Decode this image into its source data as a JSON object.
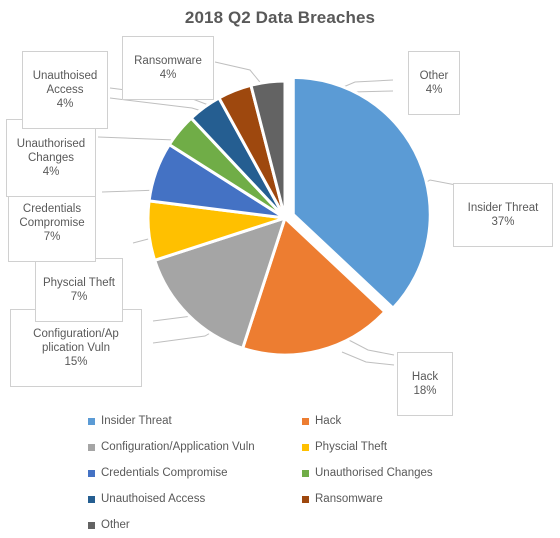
{
  "chart_data": {
    "type": "pie",
    "title": "2018 Q2 Data Breaches",
    "xlabel": "",
    "ylabel": "",
    "legend_position": "bottom",
    "grid": false,
    "start_angle_deg": 0,
    "direction": "clockwise",
    "exploded_slice_index": 0,
    "categories": [
      "Insider Threat",
      "Hack",
      "Configuration/Application Vuln",
      "Physcial Theft",
      "Credentials Compromise",
      "Unauthorised Changes",
      "Unauthoised Access",
      "Ransomware",
      "Other"
    ],
    "values": [
      37,
      18,
      15,
      7,
      7,
      4,
      4,
      4,
      4
    ],
    "value_labels": [
      "37%",
      "18%",
      "15%",
      "7%",
      "7%",
      "4%",
      "4%",
      "4%",
      "4%"
    ],
    "colors": [
      "#5B9BD5",
      "#ED7D31",
      "#A5A5A5",
      "#FFC000",
      "#4472C4",
      "#70AD47",
      "#255E91",
      "#9E480E",
      "#636363"
    ]
  },
  "callouts": [
    {
      "name": "insider-threat",
      "label": "Insider Threat",
      "pct": "37%"
    },
    {
      "name": "hack",
      "label": "Hack",
      "pct": "18%"
    },
    {
      "name": "configuration-application-vuln",
      "label": "Configuration/Ap\nplication Vuln",
      "pct": "15%"
    },
    {
      "name": "physcial-theft",
      "label": "Physcial Theft",
      "pct": "7%"
    },
    {
      "name": "credentials-compromise",
      "label": "Credentials\nCompromise",
      "pct": "7%"
    },
    {
      "name": "unauthorised-changes",
      "label": "Unauthorised\nChanges",
      "pct": "4%"
    },
    {
      "name": "unauthoised-access",
      "label": "Unauthoised\nAccess",
      "pct": "4%"
    },
    {
      "name": "ransomware",
      "label": "Ransomware",
      "pct": "4%"
    },
    {
      "name": "other",
      "label": "Other",
      "pct": "4%"
    }
  ],
  "legend": {
    "items": [
      {
        "label": "Insider Threat",
        "color": "#5B9BD5"
      },
      {
        "label": "Hack",
        "color": "#ED7D31"
      },
      {
        "label": "Configuration/Application Vuln",
        "color": "#A5A5A5"
      },
      {
        "label": "Physcial Theft",
        "color": "#FFC000"
      },
      {
        "label": "Credentials Compromise",
        "color": "#4472C4"
      },
      {
        "label": "Unauthorised Changes",
        "color": "#70AD47"
      },
      {
        "label": "Unauthoised Access",
        "color": "#255E91"
      },
      {
        "label": "Ransomware",
        "color": "#9E480E"
      },
      {
        "label": "Other",
        "color": "#636363"
      }
    ]
  }
}
